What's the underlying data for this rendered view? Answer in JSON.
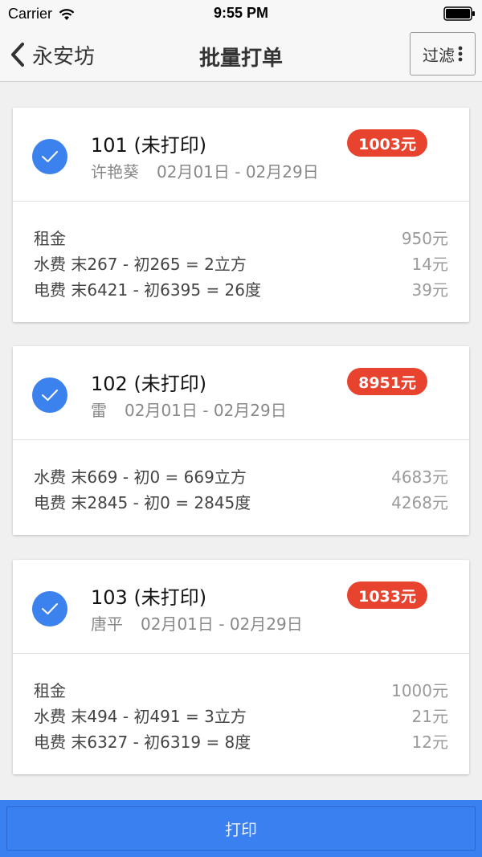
{
  "status_bar": {
    "carrier": "Carrier",
    "time": "9:55 PM"
  },
  "nav": {
    "back_label": "永安坊",
    "title": "批量打单",
    "filter_label": "过滤"
  },
  "cards": [
    {
      "title": "101 (未打印)",
      "tenant": "许艳葵",
      "period": "02月01日 - 02月29日",
      "amount": "1003元",
      "checked": true,
      "fees": [
        {
          "label": "租金",
          "amount": "950元"
        },
        {
          "label": "水费 末267 - 初265 = 2立方",
          "amount": "14元"
        },
        {
          "label": "电费 末6421 - 初6395 = 26度",
          "amount": "39元"
        }
      ]
    },
    {
      "title": "102 (未打印)",
      "tenant": "雷",
      "period": "02月01日 - 02月29日",
      "amount": "8951元",
      "checked": true,
      "fees": [
        {
          "label": "水费 末669 - 初0 = 669立方",
          "amount": "4683元"
        },
        {
          "label": "电费 末2845 - 初0 = 2845度",
          "amount": "4268元"
        }
      ]
    },
    {
      "title": "103 (未打印)",
      "tenant": "唐平",
      "period": "02月01日 - 02月29日",
      "amount": "1033元",
      "checked": true,
      "fees": [
        {
          "label": "租金",
          "amount": "1000元"
        },
        {
          "label": "水费 末494 - 初491 = 3立方",
          "amount": "21元"
        },
        {
          "label": "电费 末6327 - 初6319 = 8度",
          "amount": "12元"
        }
      ]
    }
  ],
  "print_label": "打印",
  "colors": {
    "accent_blue": "#3a80f0",
    "check_blue": "#3c82ee",
    "badge_red": "#e8432f"
  }
}
